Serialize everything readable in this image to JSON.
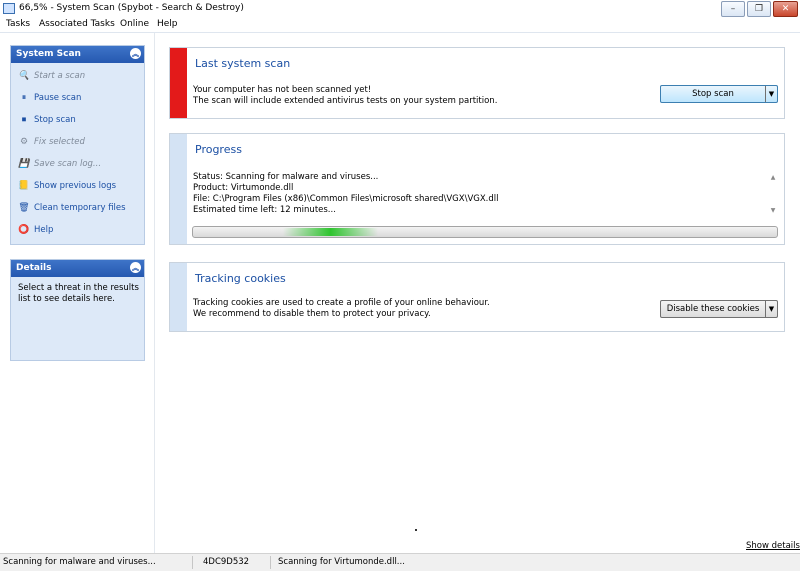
{
  "window": {
    "title": "66,5% - System Scan (Spybot - Search & Destroy)",
    "controls": {
      "minimize": "–",
      "restore": "❐",
      "close": "✕"
    }
  },
  "menu": [
    "Tasks",
    "Associated Tasks",
    "Online",
    "Help"
  ],
  "sidebar": {
    "system_scan": {
      "title": "System Scan",
      "items": [
        {
          "label": "Start a scan",
          "icon": "magnifier-icon",
          "glyph": "🔍",
          "enabled": false
        },
        {
          "label": "Pause scan",
          "icon": "pause-icon",
          "glyph": "⏸",
          "enabled": true
        },
        {
          "label": "Stop scan",
          "icon": "stop-icon",
          "glyph": "⏹",
          "enabled": true
        },
        {
          "label": "Fix selected",
          "icon": "gear-icon",
          "glyph": "⚙",
          "enabled": false
        },
        {
          "label": "Save scan log...",
          "icon": "floppy-disk-icon",
          "glyph": "💾",
          "enabled": false
        },
        {
          "label": "Show previous logs",
          "icon": "log-icon",
          "glyph": "📒",
          "enabled": true
        },
        {
          "label": "Clean temporary files",
          "icon": "cleanup-icon",
          "glyph": "🗑",
          "enabled": true
        },
        {
          "label": "Help",
          "icon": "lifebuoy-icon",
          "glyph": "⭕",
          "enabled": true
        }
      ]
    },
    "details": {
      "title": "Details",
      "text": "Select a threat in the results list to see details here."
    }
  },
  "last_scan": {
    "title": "Last system scan",
    "line1": "Your computer has not been scanned yet!",
    "line2": "The scan will include extended antivirus tests on your system partition.",
    "button": "Stop scan",
    "accent": "#e31a1a"
  },
  "progress": {
    "title": "Progress",
    "status": "Status: Scanning for malware and viruses...",
    "product": "Product: Virtumonde.dll",
    "file": "File: C:\\Program Files (x86)\\Common Files\\microsoft shared\\VGX\\VGX.dll",
    "eta": "Estimated time left: 12 minutes...",
    "accent": "#d4e3f4"
  },
  "cookies": {
    "title": "Tracking cookies",
    "line1": "Tracking cookies are used to create a profile of your online behaviour.",
    "line2": "We recommend to disable them to protect your privacy.",
    "button": "Disable these cookies",
    "accent": "#d4e3f4"
  },
  "show_details": "Show details",
  "statusbar": {
    "status": "Scanning for malware and viruses...",
    "code": "4DC9D532",
    "current": "Scanning for Virtumonde.dll..."
  }
}
